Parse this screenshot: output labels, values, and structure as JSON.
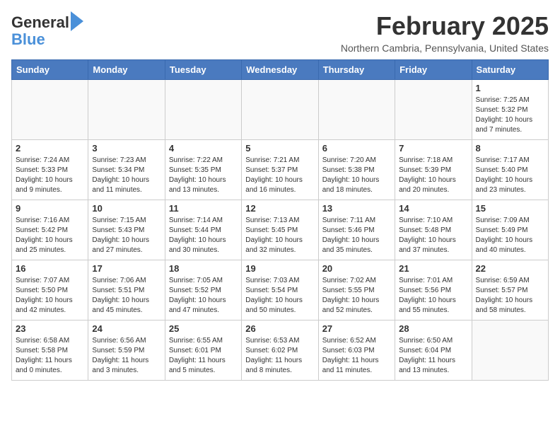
{
  "header": {
    "logo_line1": "General",
    "logo_line2": "Blue",
    "month_year": "February 2025",
    "location": "Northern Cambria, Pennsylvania, United States"
  },
  "days_of_week": [
    "Sunday",
    "Monday",
    "Tuesday",
    "Wednesday",
    "Thursday",
    "Friday",
    "Saturday"
  ],
  "weeks": [
    [
      {
        "day": "",
        "info": ""
      },
      {
        "day": "",
        "info": ""
      },
      {
        "day": "",
        "info": ""
      },
      {
        "day": "",
        "info": ""
      },
      {
        "day": "",
        "info": ""
      },
      {
        "day": "",
        "info": ""
      },
      {
        "day": "1",
        "info": "Sunrise: 7:25 AM\nSunset: 5:32 PM\nDaylight: 10 hours\nand 7 minutes."
      }
    ],
    [
      {
        "day": "2",
        "info": "Sunrise: 7:24 AM\nSunset: 5:33 PM\nDaylight: 10 hours\nand 9 minutes."
      },
      {
        "day": "3",
        "info": "Sunrise: 7:23 AM\nSunset: 5:34 PM\nDaylight: 10 hours\nand 11 minutes."
      },
      {
        "day": "4",
        "info": "Sunrise: 7:22 AM\nSunset: 5:35 PM\nDaylight: 10 hours\nand 13 minutes."
      },
      {
        "day": "5",
        "info": "Sunrise: 7:21 AM\nSunset: 5:37 PM\nDaylight: 10 hours\nand 16 minutes."
      },
      {
        "day": "6",
        "info": "Sunrise: 7:20 AM\nSunset: 5:38 PM\nDaylight: 10 hours\nand 18 minutes."
      },
      {
        "day": "7",
        "info": "Sunrise: 7:18 AM\nSunset: 5:39 PM\nDaylight: 10 hours\nand 20 minutes."
      },
      {
        "day": "8",
        "info": "Sunrise: 7:17 AM\nSunset: 5:40 PM\nDaylight: 10 hours\nand 23 minutes."
      }
    ],
    [
      {
        "day": "9",
        "info": "Sunrise: 7:16 AM\nSunset: 5:42 PM\nDaylight: 10 hours\nand 25 minutes."
      },
      {
        "day": "10",
        "info": "Sunrise: 7:15 AM\nSunset: 5:43 PM\nDaylight: 10 hours\nand 27 minutes."
      },
      {
        "day": "11",
        "info": "Sunrise: 7:14 AM\nSunset: 5:44 PM\nDaylight: 10 hours\nand 30 minutes."
      },
      {
        "day": "12",
        "info": "Sunrise: 7:13 AM\nSunset: 5:45 PM\nDaylight: 10 hours\nand 32 minutes."
      },
      {
        "day": "13",
        "info": "Sunrise: 7:11 AM\nSunset: 5:46 PM\nDaylight: 10 hours\nand 35 minutes."
      },
      {
        "day": "14",
        "info": "Sunrise: 7:10 AM\nSunset: 5:48 PM\nDaylight: 10 hours\nand 37 minutes."
      },
      {
        "day": "15",
        "info": "Sunrise: 7:09 AM\nSunset: 5:49 PM\nDaylight: 10 hours\nand 40 minutes."
      }
    ],
    [
      {
        "day": "16",
        "info": "Sunrise: 7:07 AM\nSunset: 5:50 PM\nDaylight: 10 hours\nand 42 minutes."
      },
      {
        "day": "17",
        "info": "Sunrise: 7:06 AM\nSunset: 5:51 PM\nDaylight: 10 hours\nand 45 minutes."
      },
      {
        "day": "18",
        "info": "Sunrise: 7:05 AM\nSunset: 5:52 PM\nDaylight: 10 hours\nand 47 minutes."
      },
      {
        "day": "19",
        "info": "Sunrise: 7:03 AM\nSunset: 5:54 PM\nDaylight: 10 hours\nand 50 minutes."
      },
      {
        "day": "20",
        "info": "Sunrise: 7:02 AM\nSunset: 5:55 PM\nDaylight: 10 hours\nand 52 minutes."
      },
      {
        "day": "21",
        "info": "Sunrise: 7:01 AM\nSunset: 5:56 PM\nDaylight: 10 hours\nand 55 minutes."
      },
      {
        "day": "22",
        "info": "Sunrise: 6:59 AM\nSunset: 5:57 PM\nDaylight: 10 hours\nand 58 minutes."
      }
    ],
    [
      {
        "day": "23",
        "info": "Sunrise: 6:58 AM\nSunset: 5:58 PM\nDaylight: 11 hours\nand 0 minutes."
      },
      {
        "day": "24",
        "info": "Sunrise: 6:56 AM\nSunset: 5:59 PM\nDaylight: 11 hours\nand 3 minutes."
      },
      {
        "day": "25",
        "info": "Sunrise: 6:55 AM\nSunset: 6:01 PM\nDaylight: 11 hours\nand 5 minutes."
      },
      {
        "day": "26",
        "info": "Sunrise: 6:53 AM\nSunset: 6:02 PM\nDaylight: 11 hours\nand 8 minutes."
      },
      {
        "day": "27",
        "info": "Sunrise: 6:52 AM\nSunset: 6:03 PM\nDaylight: 11 hours\nand 11 minutes."
      },
      {
        "day": "28",
        "info": "Sunrise: 6:50 AM\nSunset: 6:04 PM\nDaylight: 11 hours\nand 13 minutes."
      },
      {
        "day": "",
        "info": ""
      }
    ]
  ]
}
